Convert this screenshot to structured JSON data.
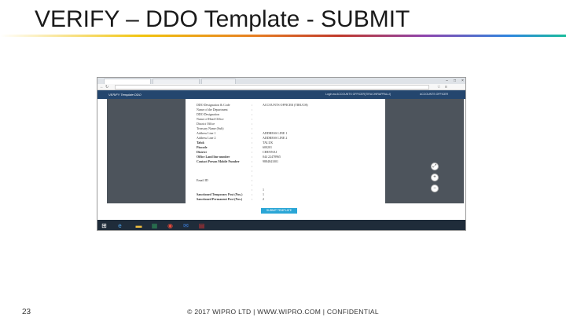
{
  "slide": {
    "title": "VERIFY – DDO Template - SUBMIT",
    "page_number": "23",
    "footer": "© 2017 WIPRO LTD | WWW.WIPRO.COM | CONFIDENTIAL"
  },
  "screenshot": {
    "app_brand": "VERIFY Template DDO",
    "user_label": "Login as ACCOUNTS OFFICER(TIRUCHIRAPPALLI)",
    "user_menu": "ACCOUNTS OFFICER",
    "submit_label": "SUBMIT TEMPLATE",
    "zoom": {
      "in": "+",
      "out": "−",
      "reset": "⤢"
    },
    "form_rows": [
      {
        "label": "DDO Designation & Code",
        "value": "ACCOUNTS OFFICER (TIRUCH)",
        "bold": false
      },
      {
        "label": "Name of the Department",
        "value": "",
        "bold": false
      },
      {
        "label": "DDO Designation",
        "value": "",
        "bold": false
      },
      {
        "label": "Name of Head Office",
        "value": "",
        "bold": false
      },
      {
        "label": "District Office",
        "value": "",
        "bold": false
      },
      {
        "label": "Treasury Name (Sub)",
        "value": "",
        "bold": false
      },
      {
        "label": "Address Line 1",
        "value": "ADDRESS LINE 1",
        "bold": false
      },
      {
        "label": "Address Line 2",
        "value": "ADDRESS LINE 2",
        "bold": false
      },
      {
        "label": "Taluk",
        "value": "TALUK",
        "bold": true
      },
      {
        "label": "Pincode",
        "value": "600201",
        "bold": true
      },
      {
        "label": "District",
        "value": "CHENNAI",
        "bold": true
      },
      {
        "label": "Office Land line number",
        "value": "044 22478965",
        "bold": true
      },
      {
        "label": "Contact Person Mobile Number",
        "value": "9884841001",
        "bold": true
      },
      {
        "label": "",
        "value": "",
        "bold": false
      },
      {
        "label": "",
        "value": "",
        "bold": false
      },
      {
        "label": "",
        "value": "",
        "bold": false
      },
      {
        "label": "Email ID",
        "value": "",
        "bold": false
      },
      {
        "label": "",
        "value": "",
        "bold": false
      },
      {
        "label": "",
        "value": "1",
        "bold": false
      },
      {
        "label": "Sanctioned Temporary Post (Nos.)",
        "value": "1",
        "bold": true
      },
      {
        "label": "Sanctioned Permanent Post (Nos.)",
        "value": "2",
        "bold": true
      }
    ]
  }
}
